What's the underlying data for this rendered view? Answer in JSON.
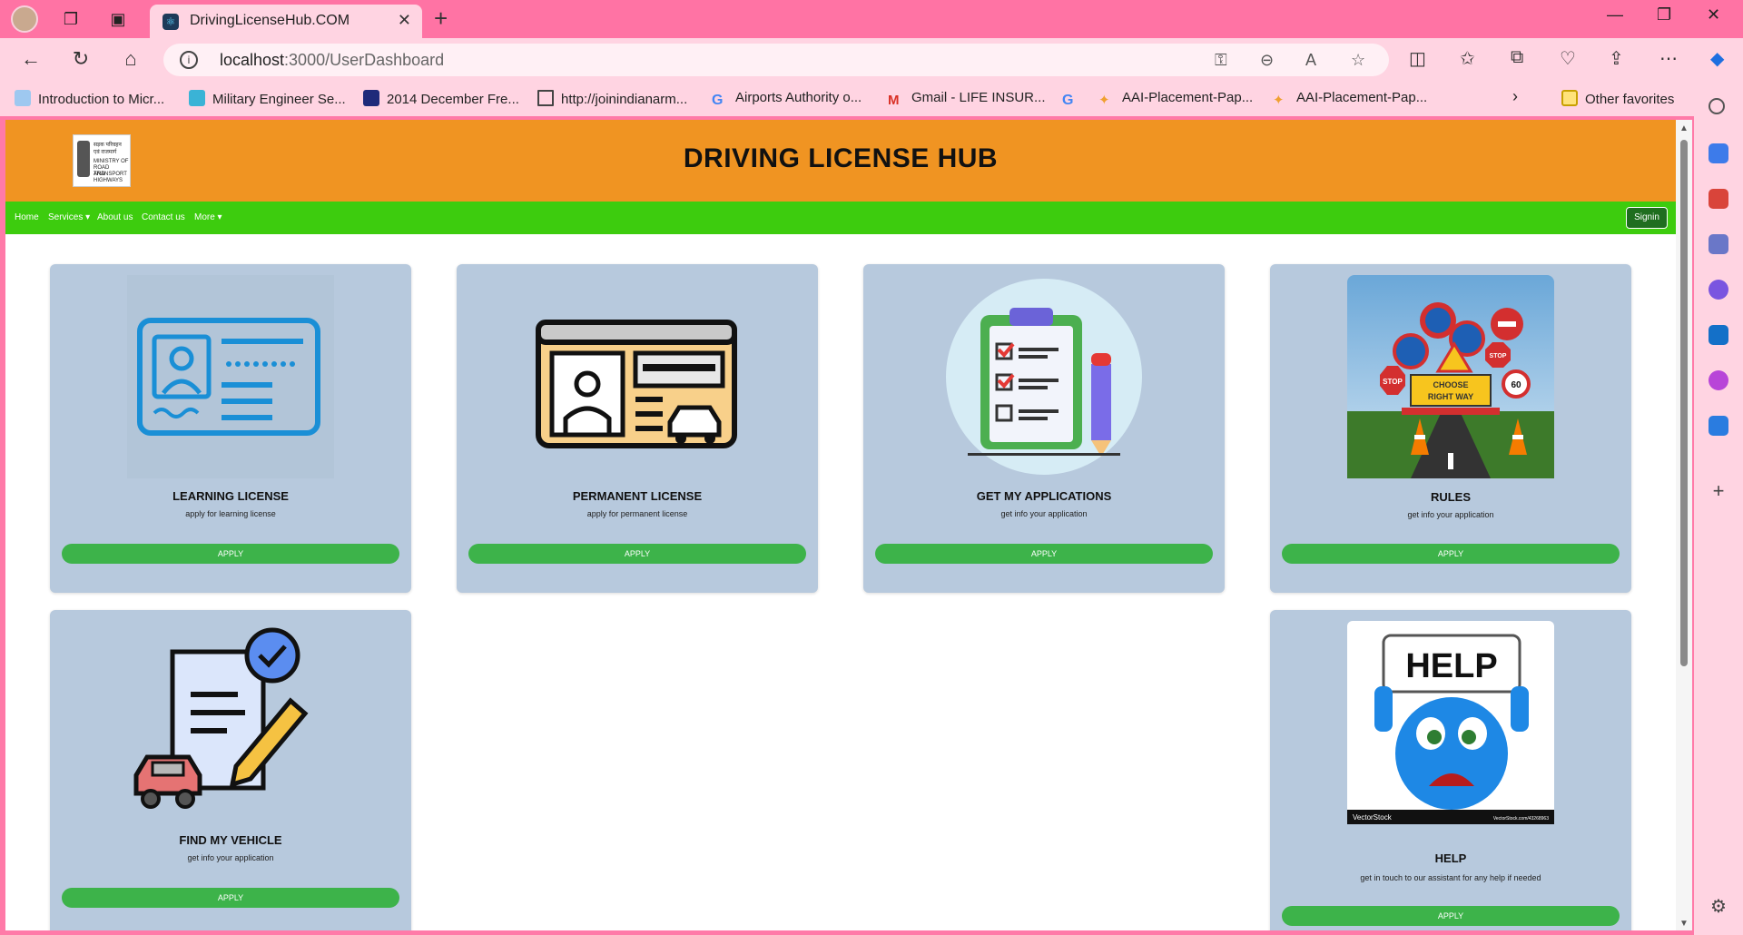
{
  "browser": {
    "tab_title": "DrivingLicenseHub.COM",
    "url_host": "localhost",
    "url_path": ":3000/UserDashboard",
    "favorites": [
      "Introduction to Micr...",
      "Military Engineer Se...",
      "2014 December Fre...",
      "http://joinindianarm...",
      "Airports Authority o...",
      "Gmail - LIFE INSUR...",
      "",
      "AAI-Placement-Pap...",
      "AAI-Placement-Pap..."
    ],
    "other_favorites": "Other favorites"
  },
  "site": {
    "title": "DRIVING LICENSE HUB",
    "nav": [
      "Home",
      "Services ▾",
      "About us",
      "Contact us",
      "More ▾"
    ],
    "signin": "Signin"
  },
  "cards": [
    {
      "title": "LEARNING LICENSE",
      "subtitle": "apply for learning license",
      "button": "APPLY"
    },
    {
      "title": "PERMANENT LICENSE",
      "subtitle": "apply for permanent license",
      "button": "APPLY"
    },
    {
      "title": "GET MY APPLICATIONS",
      "subtitle": "get info your application",
      "button": "APPLY"
    },
    {
      "title": "RULES",
      "subtitle": "get info your application",
      "button": "APPLY",
      "img_text": [
        "CHOOSE",
        "RIGHT WAY",
        "STOP",
        "STOP",
        "60"
      ]
    },
    {
      "title": "FIND MY VEHICLE",
      "subtitle": "get info your application",
      "button": "APPLY"
    },
    {
      "title": "HELP",
      "subtitle": "get in touch to our assistant for any help if needed",
      "button": "APPLY",
      "img_text": [
        "HELP",
        "VectorStock",
        "VectorStock.com/43268963"
      ]
    }
  ]
}
